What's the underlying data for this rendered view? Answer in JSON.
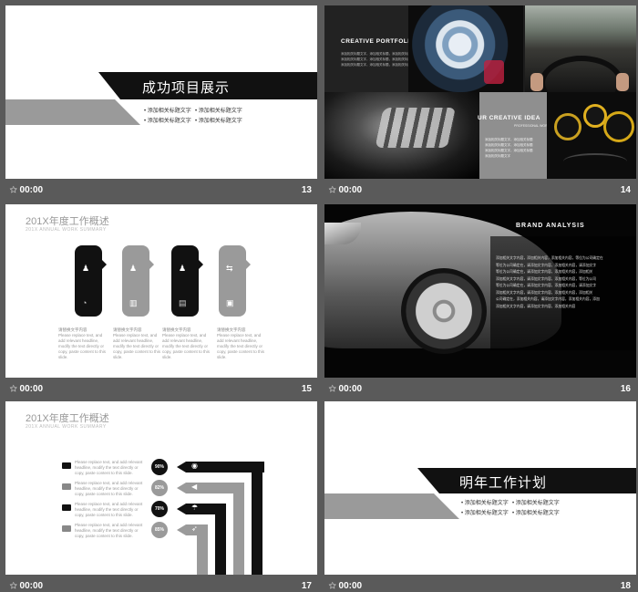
{
  "footer_time": "00:00",
  "slide13": {
    "title": "成功项目展示",
    "bullets": [
      "添加相关标题文字",
      "添加相关标题文字",
      "添加相关标题文字",
      "添加相关标题文字"
    ],
    "number": "13"
  },
  "slide14": {
    "heading1": "CREATIVE PORTFOLIO",
    "heading2": "UR CREATIVE IDEA",
    "sub2": "PROFESSIONAL WORK",
    "lines1": [
      "添加相关标题文字，添加相关标题，添加相关标题",
      "添加相关标题文字，添加相关标题，添加相关标题",
      "添加相关标题文字，添加相关标题，添加相关标题"
    ],
    "lines2": [
      "添加相关标题文字，添加相关标题",
      "添加相关标题文字，添加相关标题",
      "添加相关标题文字，添加相关标题",
      "添加相关标题文字"
    ],
    "number": "14"
  },
  "slide15": {
    "title": "201X年度工作概述",
    "subtitle": "201X ANNUAL WORK SUMMARY",
    "items": [
      {
        "label": "请替换文字内容",
        "text": "Please replace text, and add relevant headline, modify the text directly or copy, paste content to this slide."
      },
      {
        "label": "请替换文字内容",
        "text": "Please replace text, and add relevant headline, modify the text directly or copy, paste content to this slide."
      },
      {
        "label": "请替换文字内容",
        "text": "Please replace text, and add relevant headline, modify the text directly or copy, paste content to this slide."
      },
      {
        "label": "请替换文字内容",
        "text": "Please replace text, and add relevant headline, modify the text directly or copy, paste content to this slide."
      }
    ],
    "number": "15"
  },
  "slide16": {
    "heading": "BRAND ANALYSIS",
    "lines": [
      "添加相关文字内容，添加相关内容，添加相关内容，等位为公司确定在",
      "等位为公司确定在，请添加文字内容，添加相关内容，请添加文字",
      "等位为公司确定在，请添加文字内容，添加相关内容，添加相关",
      "添加相关文字内容，请添加文字内容，添加相关内容，等位为公司",
      "等位为公司确定在，请添加文字内容，添加相关内容，请添加文字",
      "添加相关文字内容，请添加文字内容，添加相关内容，添加相关",
      "公司确定在，添加相关内容，请添加文字内容，添加相关内容，添加",
      "添加相关文字内容，请添加文字内容，添加相关内容"
    ],
    "number": "16"
  },
  "slide17": {
    "title": "201X年度工作概述",
    "subtitle": "201X ANNUAL WORK SUMMARY",
    "rows": [
      {
        "pct": "90%",
        "text": "Please replace text, and add relevant headline, modify the text directly or copy, paste content to this slide."
      },
      {
        "pct": "82%",
        "text": "Please replace text, and add relevant headline, modify the text directly or copy, paste content to this slide."
      },
      {
        "pct": "70%",
        "text": "Please replace text, and add relevant headline, modify the text directly or copy, paste content to this slide."
      },
      {
        "pct": "85%",
        "text": "Please replace text, and add relevant headline, modify the text directly or copy, paste content to this slide."
      }
    ],
    "number": "17"
  },
  "slide18": {
    "title": "明年工作计划",
    "bullets": [
      "添加相关标题文字",
      "添加相关标题文字",
      "添加相关标题文字",
      "添加相关标题文字"
    ],
    "number": "18"
  }
}
